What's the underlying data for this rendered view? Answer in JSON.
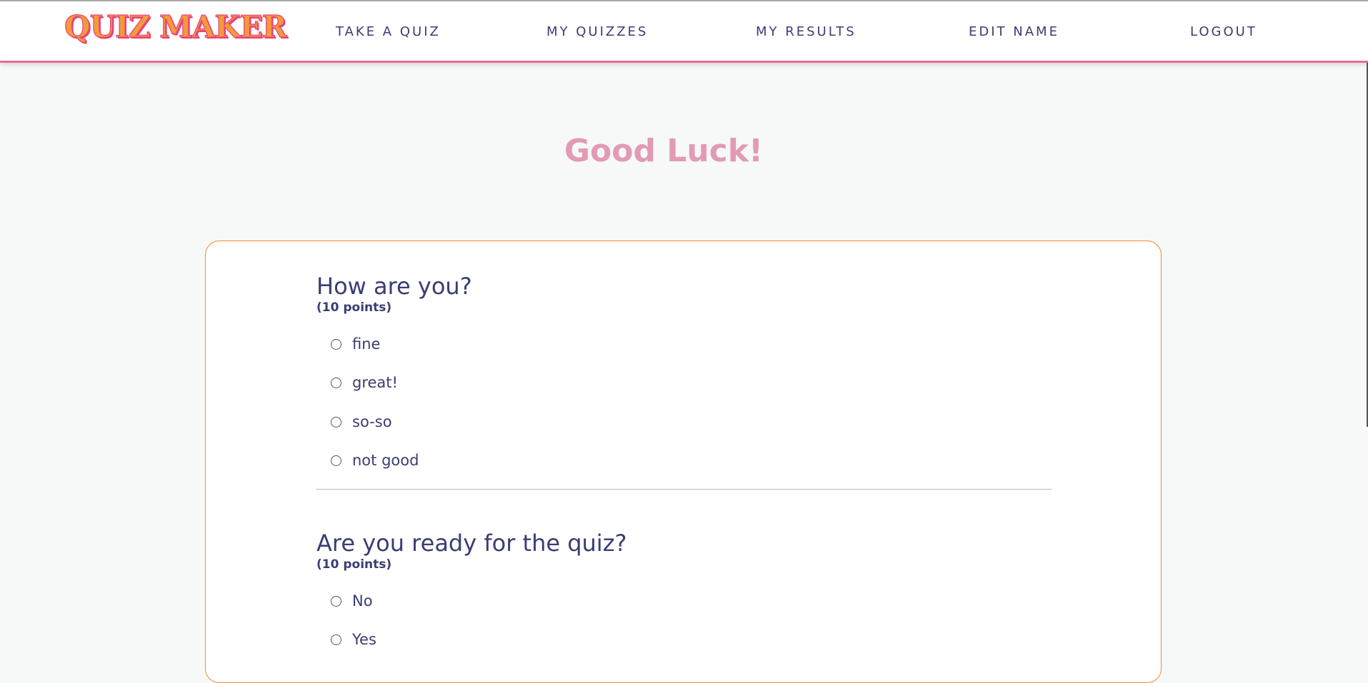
{
  "header": {
    "logo_text": "QUIZ MAKER",
    "nav": [
      {
        "label": "TAKE A QUIZ"
      },
      {
        "label": "MY QUIZZES"
      },
      {
        "label": "MY RESULTS"
      },
      {
        "label": "EDIT NAME"
      },
      {
        "label": "LOGOUT"
      }
    ]
  },
  "main": {
    "title": "Good Luck!",
    "questions": [
      {
        "title": "How are you?",
        "points": "(10 points)",
        "options": [
          "fine",
          "great!",
          "so-so",
          "not good"
        ]
      },
      {
        "title": "Are you ready for the quiz?",
        "points": "(10 points)",
        "options": [
          "No",
          "Yes"
        ]
      }
    ]
  },
  "colors": {
    "nav_text": "#3b3d72",
    "header_underline": "#e86b98",
    "title_pink": "#e29ab5",
    "card_border": "#ef8d2a",
    "logo_fill": "#f59a3a",
    "logo_outline": "#e8427c"
  }
}
